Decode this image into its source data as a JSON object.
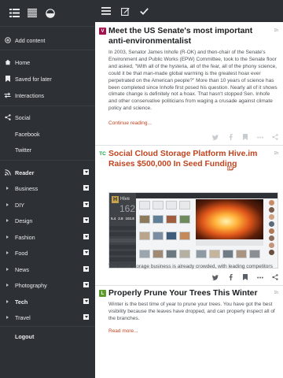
{
  "sidebar": {
    "add_content": "Add content",
    "home": "Home",
    "saved": "Saved for later",
    "interactions": "Interactions",
    "social": "Social",
    "facebook": "Facebook",
    "twitter": "Twitter",
    "reader": "Reader",
    "categories": [
      "Business",
      "DIY",
      "Design",
      "Fashion",
      "Food",
      "News",
      "Photography",
      "Tech",
      "Travel"
    ],
    "logout": "Logout"
  },
  "articles": [
    {
      "source_icon": "vox-badge-icon",
      "time": "1h",
      "title": "Meet the US Senate's most important anti-environmentalist",
      "body": "In 2003, Senator James Inhofe (R-OK) and then-chair of the Senate's Environment and Public Works (EPW) Committee, took to the Senate floor and asked, \"With all of the hysteria, all of the fear, all of the phony science, could it be that man-made global warming is the greatest hoax ever perpetrated on the American people?\" More than 10 years of science has been completed since Inhofe first posed his question. Nearly all of it shows climate change is definitely not a hoax. That hasn't stopped Sen. Inhofe and other conservative politicians from waging a crusade against climate policy and science.",
      "more": "Continue reading..."
    },
    {
      "source_icon": "techcrunch-badge-icon",
      "time": "1h",
      "title": "Social Cloud Storage Platform Hive.im Raises $500,000 In Seed Funding",
      "body": "The cloud storage business is already crowded, with leading competitors",
      "screenshot": {
        "app_name": "Hive",
        "big_number": "162",
        "stats": [
          "5.4",
          "2.8",
          "102.8"
        ]
      }
    },
    {
      "source_icon": "lifehacker-badge-icon",
      "time": "1h",
      "title": "Properly Prune Your Trees This Winter",
      "body": "Winter is the best time of year to prune your trees. You have got the best visibility because the leaves have dropped, and can properly inspect all of the branches.",
      "more": "Read more..."
    }
  ],
  "colors": {
    "sidebar_bg": "#2d3034",
    "link": "#c0441f",
    "vox": "#a3114e",
    "techcrunch": "#16a34a",
    "lifehacker": "#5d9b2b"
  }
}
